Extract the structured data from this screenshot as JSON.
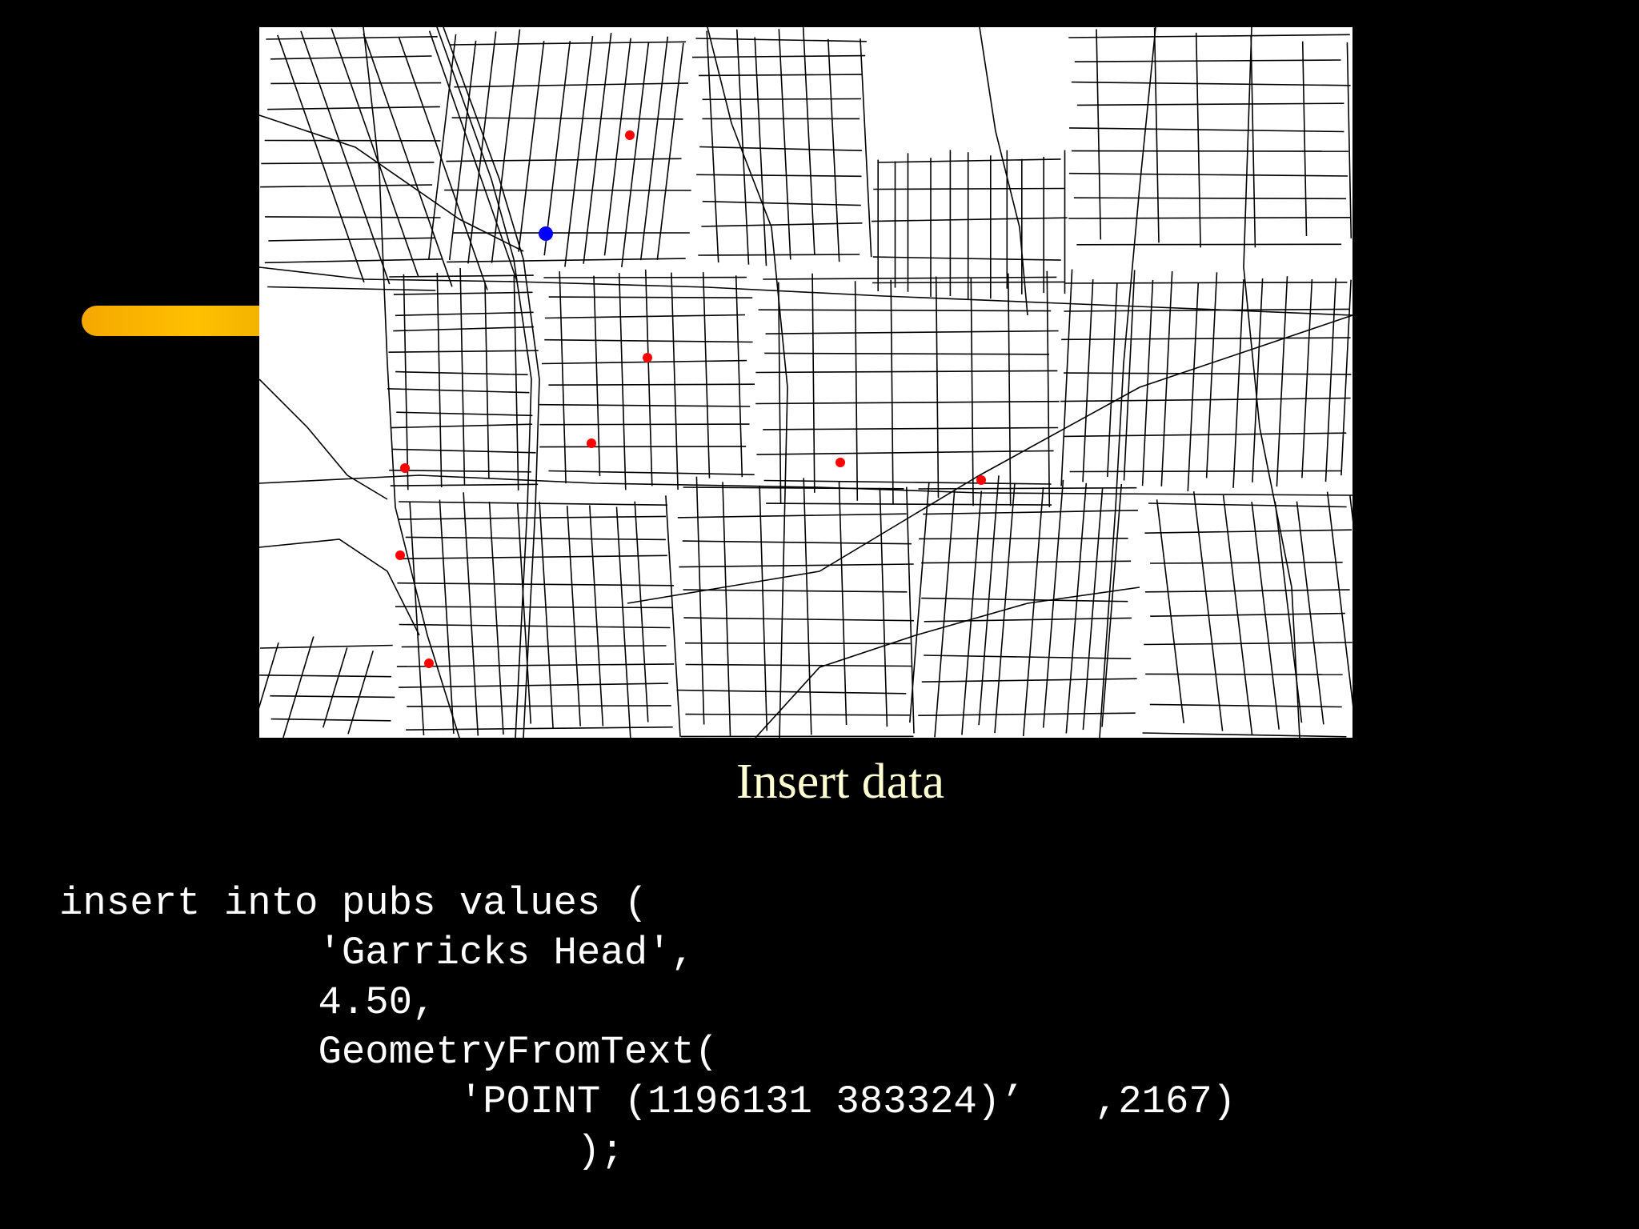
{
  "slide": {
    "title": "Insert data",
    "accent_color": "#ffc000",
    "background_color": "#000000"
  },
  "map": {
    "background_color": "#ffffff",
    "road_color": "#000000",
    "pub_marker_color": "#ff0000",
    "highlight_marker_color": "#0000ff",
    "pubs_marker_count": 9,
    "highlighted_marker_count": 1
  },
  "code": {
    "language": "SQL",
    "lines": [
      "insert into pubs values (",
      "           'Garricks Head',",
      "           4.50,",
      "           GeometryFromText(",
      "                 'POINT (1196131 383324)’   ,2167)",
      "                      );"
    ]
  }
}
